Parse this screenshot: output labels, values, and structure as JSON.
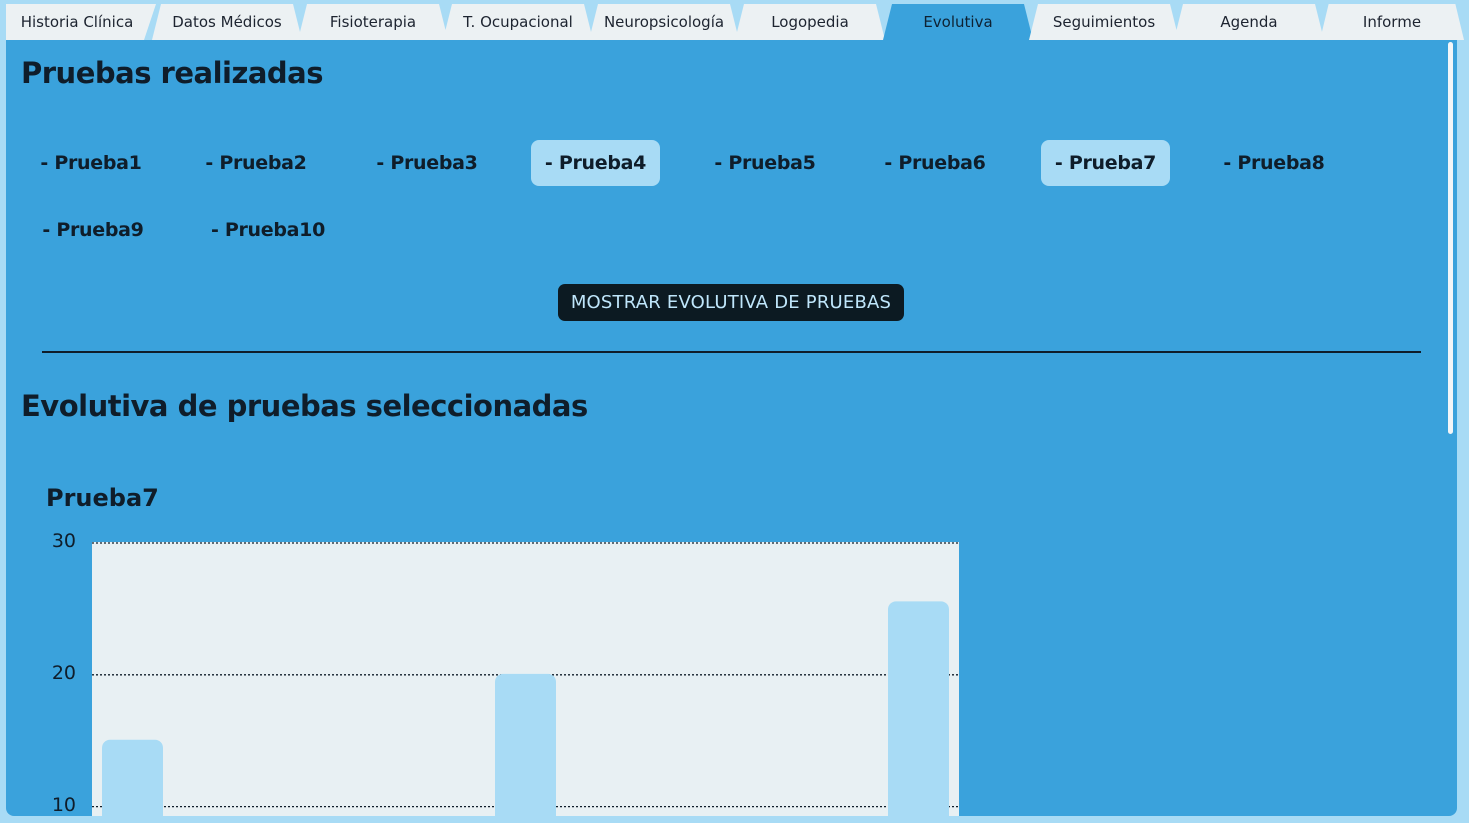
{
  "tabs": [
    {
      "label": "Historia Clínica",
      "active": false
    },
    {
      "label": "Datos Médicos",
      "active": false
    },
    {
      "label": "Fisioterapia",
      "active": false
    },
    {
      "label": "T. Ocupacional",
      "active": false
    },
    {
      "label": "Neuropsicología",
      "active": false
    },
    {
      "label": "Logopedia",
      "active": false
    },
    {
      "label": "Evolutiva",
      "active": true
    },
    {
      "label": "Seguimientos",
      "active": false
    },
    {
      "label": "Agenda",
      "active": false
    },
    {
      "label": "Informe",
      "active": false
    }
  ],
  "tests_section": {
    "title": "Pruebas realizadas",
    "tests": [
      {
        "label": "- Prueba1",
        "selected": false
      },
      {
        "label": "- Prueba2",
        "selected": false
      },
      {
        "label": "- Prueba3",
        "selected": false
      },
      {
        "label": "- Prueba4",
        "selected": true
      },
      {
        "label": "- Prueba5",
        "selected": false
      },
      {
        "label": "- Prueba6",
        "selected": false
      },
      {
        "label": "- Prueba7",
        "selected": true
      },
      {
        "label": "- Prueba8",
        "selected": false
      },
      {
        "label": "- Prueba9",
        "selected": false
      },
      {
        "label": "- Prueba10",
        "selected": false
      }
    ],
    "show_button": "MOSTRAR EVOLUTIVA DE PRUEBAS"
  },
  "evolution_section": {
    "title": "Evolutiva de pruebas seleccionadas"
  },
  "colors": {
    "panel": "#3aa2dc",
    "tab_inactive": "#ecf1f3",
    "selected_chip": "#a8dbf5",
    "bar": "#a8dbf5",
    "plot_bg": "#e8f0f3",
    "button_bg": "#0c1a22"
  },
  "chart_data": {
    "type": "bar",
    "title": "Prueba7",
    "categories": [
      "",
      "",
      ""
    ],
    "values": [
      15,
      20,
      25.5
    ],
    "ylim": [
      8,
      30
    ],
    "yticks": [
      30,
      20,
      10
    ],
    "grid": true
  }
}
